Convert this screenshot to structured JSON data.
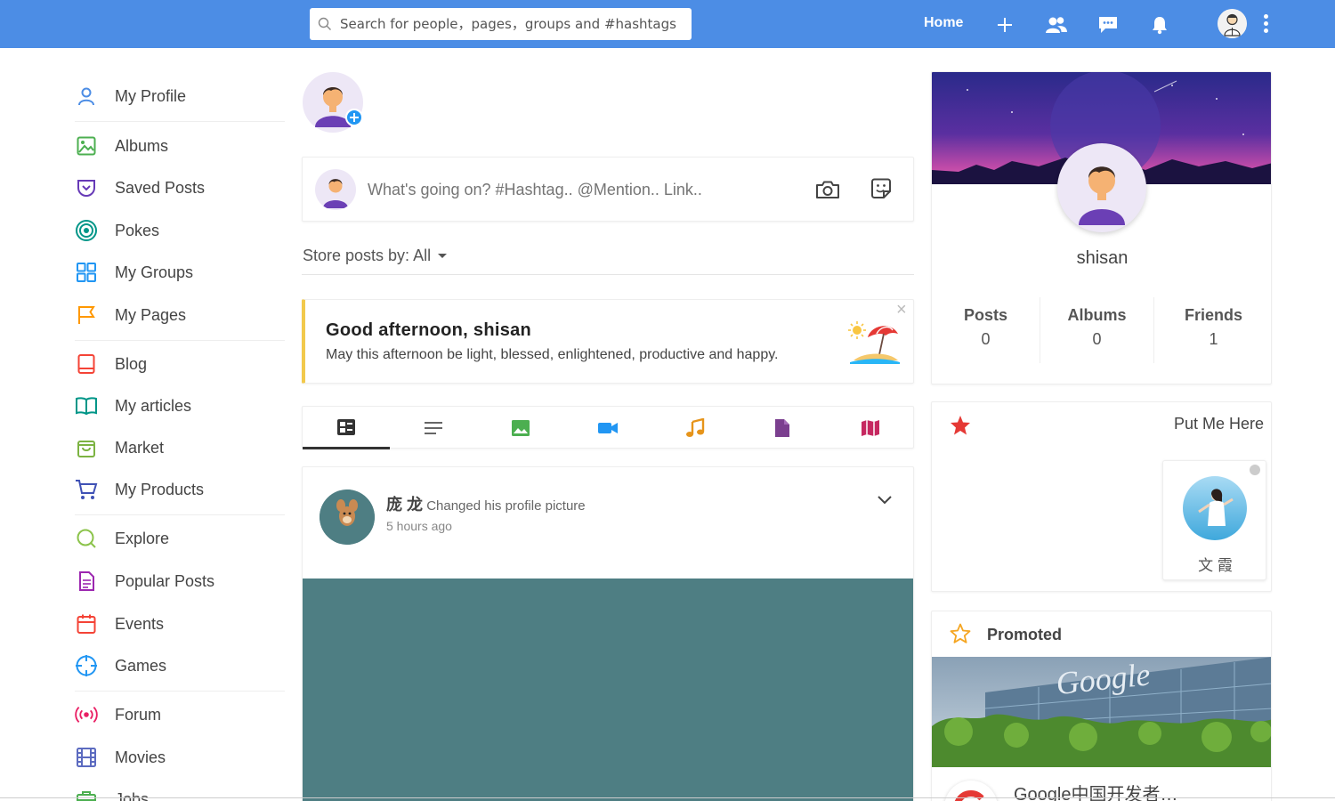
{
  "search": {
    "placeholder": "Search for people，pages，groups and #hashtags"
  },
  "topbar": {
    "home_label": "Home",
    "icons": [
      "plus-icon",
      "friends-icon",
      "messages-icon",
      "bell-icon"
    ]
  },
  "sidebar": {
    "items": [
      {
        "label": "My Profile",
        "icon": "user-icon",
        "color": "#4c8de5"
      },
      {
        "label": "Albums",
        "icon": "image-icon",
        "color": "#4caf50"
      },
      {
        "label": "Saved Posts",
        "icon": "bookmark-icon",
        "color": "#673ab7"
      },
      {
        "label": "Pokes",
        "icon": "target-icon",
        "color": "#009688"
      },
      {
        "label": "My Groups",
        "icon": "grid-icon",
        "color": "#2196f3"
      },
      {
        "label": "My Pages",
        "icon": "flag-icon",
        "color": "#ff9800"
      },
      {
        "label": "Blog",
        "icon": "book-icon",
        "color": "#f44336"
      },
      {
        "label": "My articles",
        "icon": "open-book-icon",
        "color": "#009688"
      },
      {
        "label": "Market",
        "icon": "bag-icon",
        "color": "#7cb342"
      },
      {
        "label": "My Products",
        "icon": "cart-icon",
        "color": "#3f51b5"
      },
      {
        "label": "Explore",
        "icon": "search-icon",
        "color": "#8bc34a"
      },
      {
        "label": "Popular Posts",
        "icon": "document-icon",
        "color": "#9c27b0"
      },
      {
        "label": "Events",
        "icon": "calendar-icon",
        "color": "#f44336"
      },
      {
        "label": "Games",
        "icon": "crosshair-icon",
        "color": "#2196f3"
      },
      {
        "label": "Forum",
        "icon": "broadcast-icon",
        "color": "#e91e63"
      },
      {
        "label": "Movies",
        "icon": "film-icon",
        "color": "#5c6bc0"
      },
      {
        "label": "Jobs",
        "icon": "briefcase-icon",
        "color": "#4caf50"
      }
    ]
  },
  "composer": {
    "placeholder": "What's going on? #Hashtag.. @Mention.. Link.."
  },
  "filter": {
    "label": "Store posts by: All"
  },
  "greeting": {
    "title": "Good afternoon, shisan",
    "message": "May this afternoon be light, blessed, enlightened, productive and happy.",
    "close": "×"
  },
  "post_tabs": [
    {
      "icon": "news-feed-icon",
      "color": "#333",
      "active": true
    },
    {
      "icon": "text-lines-icon",
      "color": "#666"
    },
    {
      "icon": "photo-icon",
      "color": "#4caf50"
    },
    {
      "icon": "video-icon",
      "color": "#2196f3"
    },
    {
      "icon": "music-icon",
      "color": "#e6941a"
    },
    {
      "icon": "file-icon",
      "color": "#7b3f8f"
    },
    {
      "icon": "map-icon",
      "color": "#c62860"
    }
  ],
  "post": {
    "author": "庞 龙",
    "action": "Changed his profile picture",
    "time": "5 hours ago",
    "image_color": "#4e7e83"
  },
  "profile": {
    "name": "shisan",
    "stats": [
      {
        "label": "Posts",
        "value": "0"
      },
      {
        "label": "Albums",
        "value": "0"
      },
      {
        "label": "Friends",
        "value": "1"
      }
    ]
  },
  "put_me_here": {
    "title": "Put Me Here",
    "user_name": "文 霞"
  },
  "promoted": {
    "title": "Promoted",
    "ad_title": "Google中国开发者…",
    "image_text": "Google"
  }
}
